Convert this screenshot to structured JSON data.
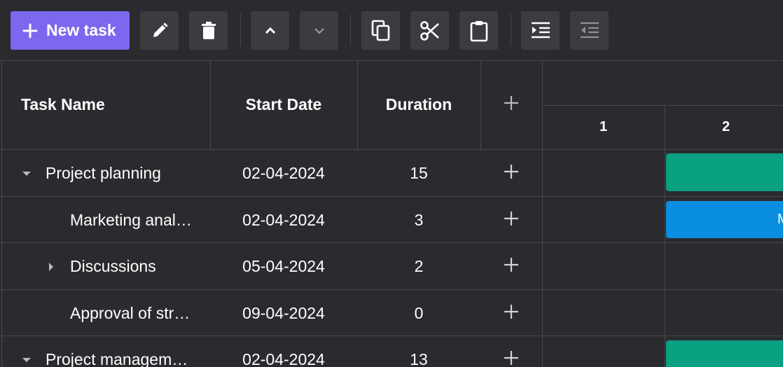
{
  "toolbar": {
    "new_task_label": "New task",
    "buttons": [
      {
        "name": "edit-button",
        "icon": "pencil-icon"
      },
      {
        "name": "delete-button",
        "icon": "trash-icon"
      },
      {
        "name": "move-up-button",
        "icon": "chevron-up-icon"
      },
      {
        "name": "move-down-button",
        "icon": "chevron-down-icon"
      },
      {
        "name": "copy-button",
        "icon": "copy-icon"
      },
      {
        "name": "cut-button",
        "icon": "scissors-icon"
      },
      {
        "name": "paste-button",
        "icon": "clipboard-icon"
      },
      {
        "name": "indent-button",
        "icon": "indent-icon"
      },
      {
        "name": "outdent-button",
        "icon": "outdent-icon"
      }
    ]
  },
  "grid": {
    "columns": {
      "task_name": "Task Name",
      "start_date": "Start Date",
      "duration": "Duration"
    },
    "rows": [
      {
        "name": "Project planning",
        "start": "02-04-2024",
        "duration": "15",
        "caret": "expanded"
      },
      {
        "name": "Marketing anal…",
        "start": "02-04-2024",
        "duration": "3",
        "caret": "none"
      },
      {
        "name": "Discussions",
        "start": "05-04-2024",
        "duration": "2",
        "caret": "collapsed"
      },
      {
        "name": "Approval of str…",
        "start": "09-04-2024",
        "duration": "0",
        "caret": "none"
      },
      {
        "name": "Project managem…",
        "start": "02-04-2024",
        "duration": "13",
        "caret": "expanded"
      }
    ]
  },
  "timeline": {
    "scale_labels": [
      "1",
      "2"
    ],
    "bar_label_partial": "M"
  },
  "colors": {
    "accent": "#7b68ee",
    "bar_project": "#0aa082",
    "bar_task": "#0a8fe0",
    "background": "#2a2b2e",
    "button_bg": "#3a3c40"
  }
}
